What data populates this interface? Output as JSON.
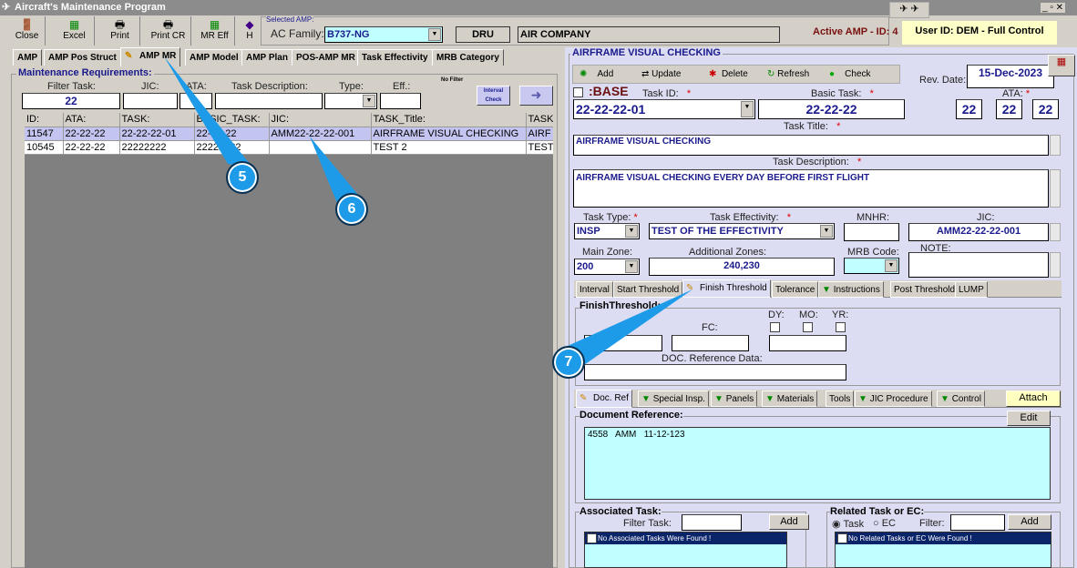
{
  "window": {
    "title": "Aircraft's Maintenance Program"
  },
  "toolbar": {
    "close": "Close",
    "excel": "Excel",
    "print": "Print",
    "print_cr": "Print CR",
    "mr_eff": "MR Eff",
    "help": "H"
  },
  "selected_amp": {
    "legend": "Selected AMP:",
    "ac_family_label": "AC Family:",
    "ac_family": "B737-NG",
    "code": "DRU",
    "company": "AIR COMPANY"
  },
  "status": {
    "active_amp": "Active AMP - ID: 4",
    "user": "User ID: DEM - Full Control"
  },
  "tabs": [
    "AMP",
    "AMP Pos Struct",
    "AMP MR",
    "AMP Model",
    "AMP Plan",
    "POS-AMP MR",
    "Task Effectivity",
    "MRB Category"
  ],
  "left": {
    "title": "Maintenance Requirements:",
    "filters": {
      "filter_task_label": "Filter Task:",
      "filter_task": "22",
      "jic_label": "JIC:",
      "ata_label": "ATA:",
      "desc_label": "Task Description:",
      "type_label": "Type:",
      "eff_label": "Eff.:",
      "no_filter": "No Filter",
      "interval_check": "Interval Check"
    },
    "columns": [
      "ID:",
      "ATA:",
      "TASK:",
      "BASIC_TASK:",
      "JIC:",
      "TASK_Title:",
      "TASK"
    ],
    "rows": [
      [
        "11547",
        "22-22-22",
        "22-22-22-01",
        "22-22-22",
        "AMM22-22-22-001",
        "AIRFRAME VISUAL CHECKING",
        "AIRF"
      ],
      [
        "10545",
        "22-22-22",
        "22222222",
        "22222222",
        "",
        "TEST 2",
        "TEST"
      ]
    ]
  },
  "editor": {
    "title": "AIRFRAME VISUAL CHECKING",
    "add": "Add",
    "update": "Update",
    "delete": "Delete",
    "refresh": "Refresh",
    "check": "Check",
    "rev_date_label": "Rev. Date:",
    "rev_date": "15-Dec-2023",
    "base": ":BASE",
    "task_id_label": "Task ID:",
    "task_id": "22-22-22-01",
    "basic_task_label": "Basic Task:",
    "basic_task": "22-22-22",
    "ata_label": "ATA:",
    "ata": [
      "22",
      "22",
      "22"
    ],
    "title_label": "Task Title:",
    "desc_label": "Task Description:",
    "desc": "AIRFRAME VISUAL CHECKING EVERY DAY BEFORE FIRST FLIGHT",
    "type_label": "Task Type:",
    "type": "INSP",
    "eff_label": "Task Effectivity:",
    "eff": "TEST OF THE EFFECTIVITY",
    "mnhr_label": "MNHR:",
    "jic_label": "JIC:",
    "jic": "AMM22-22-22-001",
    "zone_label": "Main Zone:",
    "zone": "200",
    "addzones_label": "Additional Zones:",
    "addzones": "240,230",
    "mrb_label": "MRB Code:",
    "note_label": "NOTE:",
    "star": "*"
  },
  "subtabs": [
    "Interval",
    "Start Threshold",
    "Finish Threshold",
    "Tolerance",
    "Instructions",
    "Post Threshold",
    "LUMP"
  ],
  "finish": {
    "title": "FinishThreshold:",
    "fc": "FC:",
    "dy": "DY:",
    "mo": "MO:",
    "yr": "YR:",
    "doc": "DOC. Reference Data:"
  },
  "doctabs": [
    "Doc. Ref",
    "Special Insp.",
    "Panels",
    "Materials",
    "Tools",
    "JIC Procedure",
    "Control"
  ],
  "attach": "Attach",
  "docref": {
    "title": "Document Reference:",
    "edit": "Edit",
    "text": "4558   AMM   11-12-123"
  },
  "assoc": {
    "title": "Associated Task:",
    "filter_label": "Filter Task:",
    "add": "Add",
    "empty": "No Associated Tasks Were Found !"
  },
  "related": {
    "title": "Related Task or EC:",
    "task": "Task",
    "ec": "EC",
    "filter_label": "Filter:",
    "add": "Add",
    "empty": "No Related Tasks or EC Were Found !"
  },
  "callouts": [
    "5",
    "6",
    "7"
  ]
}
